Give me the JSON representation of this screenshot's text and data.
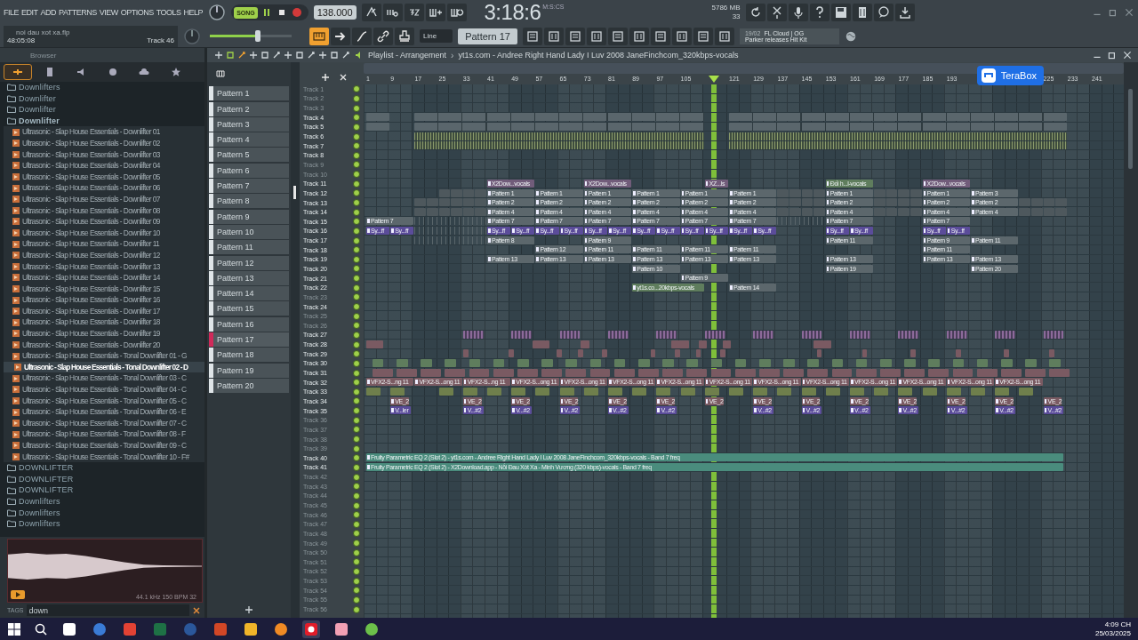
{
  "menu": [
    "FILE",
    "EDIT",
    "ADD",
    "PATTERNS",
    "VIEW",
    "OPTIONS",
    "TOOLS",
    "HELP"
  ],
  "transport": {
    "song_label": "SONG",
    "song_on": true,
    "tempo": "138.000",
    "time": "3:18:6",
    "time_unit": "M:S:CS",
    "memory": "5786 MB",
    "cpu": "33"
  },
  "hint": {
    "file": "noi dau xot xa.flp",
    "position": "48:05:08",
    "track": "Track 46"
  },
  "master": {
    "level": 0.59
  },
  "tool_toggle": {
    "on": true
  },
  "snap": "Line",
  "pattern_selector": "Pattern 17",
  "news": {
    "date": "19/02",
    "title": "FL Cloud | OG",
    "text": "Parker releases Hit Kit"
  },
  "browser": {
    "title": "Browser",
    "tabs": [
      {
        "selected": true
      },
      {
        "selected": false
      },
      {
        "selected": false
      },
      {
        "selected": false
      },
      {
        "selected": false
      },
      {
        "selected": false
      }
    ],
    "tree": [
      {
        "label": "Downlifters",
        "expanded": false
      },
      {
        "label": "Downlifter",
        "expanded": false
      },
      {
        "label": "Downlifter",
        "expanded": false
      },
      {
        "label": "Downlifter",
        "expanded": true,
        "children": [
          {
            "label": "Ultrasonic - Slap House Essentials - Downlifter 01",
            "selected": false
          },
          {
            "label": "Ultrasonic - Slap House Essentials - Downlifter 02",
            "selected": false
          },
          {
            "label": "Ultrasonic - Slap House Essentials - Downlifter 03",
            "selected": false
          },
          {
            "label": "Ultrasonic - Slap House Essentials - Downlifter 04",
            "selected": false
          },
          {
            "label": "Ultrasonic - Slap House Essentials - Downlifter 05",
            "selected": false
          },
          {
            "label": "Ultrasonic - Slap House Essentials - Downlifter 06",
            "selected": false
          },
          {
            "label": "Ultrasonic - Slap House Essentials - Downlifter 07",
            "selected": false
          },
          {
            "label": "Ultrasonic - Slap House Essentials - Downlifter 08",
            "selected": false
          },
          {
            "label": "Ultrasonic - Slap House Essentials - Downlifter 09",
            "selected": false
          },
          {
            "label": "Ultrasonic - Slap House Essentials - Downlifter 10",
            "selected": false
          },
          {
            "label": "Ultrasonic - Slap House Essentials - Downlifter 11",
            "selected": false
          },
          {
            "label": "Ultrasonic - Slap House Essentials - Downlifter 12",
            "selected": false
          },
          {
            "label": "Ultrasonic - Slap House Essentials - Downlifter 13",
            "selected": false
          },
          {
            "label": "Ultrasonic - Slap House Essentials - Downlifter 14",
            "selected": false
          },
          {
            "label": "Ultrasonic - Slap House Essentials - Downlifter 15",
            "selected": false
          },
          {
            "label": "Ultrasonic - Slap House Essentials - Downlifter 16",
            "selected": false
          },
          {
            "label": "Ultrasonic - Slap House Essentials - Downlifter 17",
            "selected": false
          },
          {
            "label": "Ultrasonic - Slap House Essentials - Downlifter 18",
            "selected": false
          },
          {
            "label": "Ultrasonic - Slap House Essentials - Downlifter 19",
            "selected": false
          },
          {
            "label": "Ultrasonic - Slap House Essentials - Downlifter 20",
            "selected": false
          },
          {
            "label": "Ultrasonic - Slap House Essentials - Tonal Downlifter 01 - G",
            "selected": false
          },
          {
            "label": "Ultrasonic - Slap House Essentials - Tonal Downlifter 02 - D",
            "selected": true
          },
          {
            "label": "Ultrasonic - Slap House Essentials - Tonal Downlifter 03 - C",
            "selected": false
          },
          {
            "label": "Ultrasonic - Slap House Essentials - Tonal Downlifter 04 - C",
            "selected": false
          },
          {
            "label": "Ultrasonic - Slap House Essentials - Tonal Downlifter 05 - C",
            "selected": false
          },
          {
            "label": "Ultrasonic - Slap House Essentials - Tonal Downlifter 06 - E",
            "selected": false
          },
          {
            "label": "Ultrasonic - Slap House Essentials - Tonal Downlifter 07 - C",
            "selected": false
          },
          {
            "label": "Ultrasonic - Slap House Essentials - Tonal Downlifter 08 - F",
            "selected": false
          },
          {
            "label": "Ultrasonic - Slap House Essentials - Tonal Downlifter 09 - C",
            "selected": false
          },
          {
            "label": "Ultrasonic - Slap House Essentials - Tonal Downlifter 10 - F#",
            "selected": false
          }
        ]
      },
      {
        "label": "DOWNLIFTER",
        "expanded": false
      },
      {
        "label": "DOWNLIFTER",
        "expanded": false
      },
      {
        "label": "DOWNLIFTER",
        "expanded": false
      },
      {
        "label": "Downlifters",
        "expanded": false
      },
      {
        "label": "Downlifters",
        "expanded": false
      },
      {
        "label": "Downlifters",
        "expanded": false
      }
    ],
    "sample_info": "44.1 kHz 150 BPM 32",
    "tags_label": "TAGS",
    "search": "down"
  },
  "playlist": {
    "title": "Playlist - Arrangement",
    "separator": "›",
    "arrangement": "yt1s.com - Andree Right Hand  Lady I Luv 2008 JaneFinchcom_320kbps-vocals"
  },
  "patterns": [
    {
      "label": "Pattern 1",
      "selected": false
    },
    {
      "label": "Pattern 2",
      "selected": false
    },
    {
      "label": "Pattern 3",
      "selected": false
    },
    {
      "label": "Pattern 4",
      "selected": false
    },
    {
      "label": "Pattern 5",
      "selected": false
    },
    {
      "label": "Pattern 6",
      "selected": false
    },
    {
      "label": "Pattern 7",
      "selected": false
    },
    {
      "label": "Pattern 8",
      "selected": false
    },
    {
      "label": "Pattern 9",
      "selected": false
    },
    {
      "label": "Pattern 10",
      "selected": false
    },
    {
      "label": "Pattern 11",
      "selected": false
    },
    {
      "label": "Pattern 12",
      "selected": false
    },
    {
      "label": "Pattern 13",
      "selected": false
    },
    {
      "label": "Pattern 14",
      "selected": false
    },
    {
      "label": "Pattern 15",
      "selected": false
    },
    {
      "label": "Pattern 16",
      "selected": false
    },
    {
      "label": "Pattern 17",
      "selected": true
    },
    {
      "label": "Pattern 18",
      "selected": false
    },
    {
      "label": "Pattern 19",
      "selected": false
    },
    {
      "label": "Pattern 20",
      "selected": false
    }
  ],
  "ruler": [
    "1",
    "9",
    "17",
    "25",
    "33",
    "41",
    "49",
    "57",
    "65",
    "73",
    "81",
    "89",
    "97",
    "105",
    "121",
    "129",
    "137",
    "145",
    "153",
    "161",
    "169",
    "177",
    "185",
    "193",
    "225",
    "233",
    "241"
  ],
  "playhead": {
    "level": 0.461
  },
  "overlay_badge": "TeraBox",
  "tracks": [
    {
      "name": "Track 1",
      "empty": true
    },
    {
      "name": "Track 2",
      "empty": true
    },
    {
      "name": "Track 3",
      "empty": true
    },
    {
      "name": "Track 4",
      "empty": false
    },
    {
      "name": "Track 5",
      "empty": false
    },
    {
      "name": "Track 6",
      "empty": false
    },
    {
      "name": "Track 7",
      "empty": false
    },
    {
      "name": "Track 8",
      "empty": false
    },
    {
      "name": "Track 9",
      "empty": true
    },
    {
      "name": "Track 10",
      "empty": true
    },
    {
      "name": "Track 11",
      "empty": false,
      "clips": [
        {
          "kind": "audio",
          "label": "X2Dow...vocals"
        },
        {
          "kind": "audio",
          "label": "X2Dow...vocals"
        },
        {
          "kind": "audio",
          "label": "XZ...ls"
        },
        {
          "kind": "sound",
          "label": "Đối h...l-vocals"
        },
        {
          "kind": "audio",
          "label": "X2Dow...vocals"
        }
      ]
    },
    {
      "name": "Track 12",
      "empty": false,
      "clips": [
        {
          "kind": "pattern",
          "label": "Pattern 1"
        },
        {
          "kind": "pattern",
          "label": "Pattern 1"
        },
        {
          "kind": "pattern",
          "label": "Pattern 1"
        },
        {
          "kind": "pattern",
          "label": "Pattern 1"
        },
        {
          "kind": "pattern",
          "label": "Pattern 1"
        },
        {
          "kind": "pattern",
          "label": "Pattern 1"
        },
        {
          "kind": "pattern",
          "label": "Pattern 1"
        },
        {
          "kind": "pattern",
          "label": "Pattern 1"
        },
        {
          "kind": "pattern",
          "label": "Pattern 3"
        }
      ]
    },
    {
      "name": "Track 13",
      "empty": false,
      "clips": [
        {
          "kind": "pattern",
          "label": "Pattern 2"
        },
        {
          "kind": "pattern",
          "label": "Pattern 2"
        },
        {
          "kind": "pattern",
          "label": "Pattern 2"
        },
        {
          "kind": "pattern",
          "label": "Pattern 2"
        },
        {
          "kind": "pattern",
          "label": "Pattern 2"
        },
        {
          "kind": "pattern",
          "label": "Pattern 2"
        },
        {
          "kind": "pattern",
          "label": "Pattern 2"
        },
        {
          "kind": "pattern",
          "label": "Pattern 2"
        },
        {
          "kind": "pattern",
          "label": "Pattern 2"
        }
      ]
    },
    {
      "name": "Track 14",
      "empty": false,
      "clips": [
        {
          "kind": "pattern",
          "label": "Pattern 4"
        },
        {
          "kind": "pattern",
          "label": "Pattern 4"
        },
        {
          "kind": "pattern",
          "label": "Pattern 4"
        },
        {
          "kind": "pattern",
          "label": "Pattern 4"
        },
        {
          "kind": "pattern",
          "label": "Pattern 4"
        },
        {
          "kind": "pattern",
          "label": "Pattern 4"
        },
        {
          "kind": "pattern",
          "label": "Pattern 4"
        },
        {
          "kind": "pattern",
          "label": "Pattern 4"
        },
        {
          "kind": "pattern",
          "label": "Pattern 4"
        }
      ]
    },
    {
      "name": "Track 15",
      "empty": false,
      "clips": [
        {
          "kind": "pattern",
          "label": "Pattern 7"
        },
        {
          "kind": "pattern",
          "label": "Pattern 7"
        },
        {
          "kind": "pattern",
          "label": "Pattern 7"
        },
        {
          "kind": "pattern",
          "label": "Pattern 7"
        },
        {
          "kind": "pattern",
          "label": "Pattern 7"
        },
        {
          "kind": "pattern",
          "label": "Pattern 7"
        },
        {
          "kind": "pattern",
          "label": "Pattern 7"
        },
        {
          "kind": "pattern",
          "label": "Pattern 7"
        },
        {
          "kind": "pattern",
          "label": "Pattern 7"
        }
      ]
    },
    {
      "name": "Track 16",
      "empty": false,
      "clips": [
        {
          "kind": "automation",
          "label": "Sy...ff"
        },
        {
          "kind": "automation",
          "label": "Sy...ff"
        },
        {
          "kind": "automation",
          "label": "Sy...ff"
        },
        {
          "kind": "automation",
          "label": "Sy...ff"
        },
        {
          "kind": "automation",
          "label": "Sy...ff"
        },
        {
          "kind": "automation",
          "label": "Sy...ff"
        },
        {
          "kind": "automation",
          "label": "Sy...ff"
        },
        {
          "kind": "automation",
          "label": "Sy...ff"
        },
        {
          "kind": "automation",
          "label": "Sy...ff"
        },
        {
          "kind": "automation",
          "label": "Sy...ff"
        },
        {
          "kind": "automation",
          "label": "Sy...ff"
        },
        {
          "kind": "automation",
          "label": "Sy...ff"
        },
        {
          "kind": "automation",
          "label": "Sy...ff"
        },
        {
          "kind": "automation",
          "label": "Sy...ff"
        },
        {
          "kind": "automation",
          "label": "Sy...ff"
        },
        {
          "kind": "automation",
          "label": "Sy...ff"
        },
        {
          "kind": "automation",
          "label": "Sy...ff"
        },
        {
          "kind": "automation",
          "label": "Sy...ff"
        }
      ]
    },
    {
      "name": "Track 17",
      "empty": false,
      "clips": [
        {
          "kind": "pattern",
          "label": "Pattern 8"
        },
        {
          "kind": "pattern",
          "label": "Pattern 9"
        },
        {
          "kind": "pattern",
          "label": "Pattern 11"
        },
        {
          "kind": "pattern",
          "label": "Pattern 9"
        },
        {
          "kind": "pattern",
          "label": "Pattern 11"
        }
      ]
    },
    {
      "name": "Track 18",
      "empty": false,
      "clips": [
        {
          "kind": "pattern",
          "label": "Pattern 12"
        },
        {
          "kind": "pattern",
          "label": "Pattern 11"
        },
        {
          "kind": "pattern",
          "label": "Pattern 11"
        },
        {
          "kind": "pattern",
          "label": "Pattern 11"
        },
        {
          "kind": "pattern",
          "label": "Pattern 11"
        },
        {
          "kind": "pattern",
          "label": "Pattern 11"
        }
      ]
    },
    {
      "name": "Track 19",
      "empty": false,
      "clips": [
        {
          "kind": "pattern",
          "label": "Pattern 13"
        },
        {
          "kind": "pattern",
          "label": "Pattern 13"
        },
        {
          "kind": "pattern",
          "label": "Pattern 13"
        },
        {
          "kind": "pattern",
          "label": "Pattern 13"
        },
        {
          "kind": "pattern",
          "label": "Pattern 13"
        },
        {
          "kind": "pattern",
          "label": "Pattern 13"
        },
        {
          "kind": "pattern",
          "label": "Pattern 13"
        },
        {
          "kind": "pattern",
          "label": "Pattern 13"
        },
        {
          "kind": "pattern",
          "label": "Pattern 13"
        }
      ]
    },
    {
      "name": "Track 20",
      "empty": false,
      "clips": [
        {
          "kind": "pattern",
          "label": "Pattern 10"
        },
        {
          "kind": "pattern",
          "label": "Pattern 19"
        },
        {
          "kind": "pattern",
          "label": "Pattern 20"
        }
      ]
    },
    {
      "name": "Track 21",
      "empty": false,
      "clips": [
        {
          "kind": "pattern",
          "label": "Pattern 9"
        }
      ]
    },
    {
      "name": "Track 22",
      "empty": false,
      "clips": [
        {
          "kind": "sound",
          "label": "yt1s.co...20kbps-vocals"
        },
        {
          "kind": "pattern",
          "label": "Pattern 14"
        }
      ]
    },
    {
      "name": "Track 23",
      "empty": true
    },
    {
      "name": "Track 24",
      "empty": false
    },
    {
      "name": "Track 25",
      "empty": true
    },
    {
      "name": "Track 26",
      "empty": true
    },
    {
      "name": "Track 27",
      "empty": false
    },
    {
      "name": "Track 28",
      "empty": false
    },
    {
      "name": "Track 29",
      "empty": false
    },
    {
      "name": "Track 30",
      "empty": false
    },
    {
      "name": "Track 31",
      "empty": false
    },
    {
      "name": "Track 32",
      "empty": false,
      "clips": [
        {
          "kind": "fx",
          "label": "VFX2-S...ng 11"
        },
        {
          "kind": "fx",
          "label": "VFX2-S...ong 11"
        },
        {
          "kind": "fx",
          "label": "VFX2-S...ng 11"
        },
        {
          "kind": "fx",
          "label": "VFX2-S...ong 11"
        },
        {
          "kind": "fx",
          "label": "VFX2-S...ong 11"
        },
        {
          "kind": "fx",
          "label": "VFX2-S...ong 11"
        },
        {
          "kind": "fx",
          "label": "VFX2-S...ong 11"
        },
        {
          "kind": "fx",
          "label": "VFX2-S...ong 11"
        },
        {
          "kind": "fx",
          "label": "VFX2-S...ong 11"
        },
        {
          "kind": "fx",
          "label": "VFX2-S...ong 11"
        },
        {
          "kind": "fx",
          "label": "VFX2-S...ong 11"
        },
        {
          "kind": "fx",
          "label": "VFX2-S...ong 11"
        },
        {
          "kind": "fx",
          "label": "VFX2-S...ong 11"
        },
        {
          "kind": "fx",
          "label": "VFX2-S...ong 11"
        }
      ]
    },
    {
      "name": "Track 33",
      "empty": false
    },
    {
      "name": "Track 34",
      "empty": false,
      "clips": [
        {
          "kind": "fx",
          "label": "VE_2"
        },
        {
          "kind": "fx",
          "label": "VE_2"
        },
        {
          "kind": "fx",
          "label": "VE_2"
        },
        {
          "kind": "fx",
          "label": "VE_2"
        },
        {
          "kind": "fx",
          "label": "VE_2"
        },
        {
          "kind": "fx",
          "label": "VE_2"
        },
        {
          "kind": "fx",
          "label": "VE_2"
        },
        {
          "kind": "fx",
          "label": "VE_2"
        },
        {
          "kind": "fx",
          "label": "VE_2"
        },
        {
          "kind": "fx",
          "label": "VE_2"
        },
        {
          "kind": "fx",
          "label": "VE_2"
        },
        {
          "kind": "fx",
          "label": "VE_2"
        },
        {
          "kind": "fx",
          "label": "VE_2"
        },
        {
          "kind": "fx",
          "label": "VE_2"
        }
      ]
    },
    {
      "name": "Track 35",
      "empty": false,
      "clips": [
        {
          "kind": "automation",
          "label": "V...ler"
        },
        {
          "kind": "automation",
          "label": "V...#2"
        },
        {
          "kind": "automation",
          "label": "V...#2"
        },
        {
          "kind": "automation",
          "label": "V...#2"
        },
        {
          "kind": "automation",
          "label": "V...#2"
        },
        {
          "kind": "automation",
          "label": "V...#2"
        },
        {
          "kind": "automation",
          "label": "V...#2"
        },
        {
          "kind": "automation",
          "label": "V...#2"
        },
        {
          "kind": "automation",
          "label": "V...#2"
        },
        {
          "kind": "automation",
          "label": "V...#2"
        },
        {
          "kind": "automation",
          "label": "V...#2"
        },
        {
          "kind": "automation",
          "label": "V...#2"
        },
        {
          "kind": "automation",
          "label": "V...#2"
        }
      ]
    },
    {
      "name": "Track 36",
      "empty": true
    },
    {
      "name": "Track 37",
      "empty": true
    },
    {
      "name": "Track 38",
      "empty": true
    },
    {
      "name": "Track 39",
      "empty": true
    },
    {
      "name": "Track 40",
      "empty": false,
      "clips": [
        {
          "kind": "eq",
          "label": "Fruity Parametric EQ 2 (Slot 2) - yt1s.com - Andree Right Hand  Lady I Luv 2008 JaneFinchcom_320kbps-vocals - Band 7 freq"
        }
      ]
    },
    {
      "name": "Track 41",
      "empty": false,
      "clips": [
        {
          "kind": "eq",
          "label": "Fruity Parametric EQ 2 (Slot 2) - X2Download.app - Nỗi Đau Xót Xa - Minh Vương (320 kbps)-vocals - Band 7 freq"
        }
      ]
    },
    {
      "name": "Track 42",
      "empty": true
    },
    {
      "name": "Track 43",
      "empty": true
    },
    {
      "name": "Track 44",
      "empty": true
    },
    {
      "name": "Track 45",
      "empty": true
    },
    {
      "name": "Track 46",
      "empty": true
    },
    {
      "name": "Track 47",
      "empty": true
    },
    {
      "name": "Track 48",
      "empty": true
    },
    {
      "name": "Track 49",
      "empty": true
    },
    {
      "name": "Track 50",
      "empty": true
    },
    {
      "name": "Track 51",
      "empty": true
    },
    {
      "name": "Track 52",
      "empty": true
    },
    {
      "name": "Track 53",
      "empty": true
    },
    {
      "name": "Track 54",
      "empty": true
    },
    {
      "name": "Track 55",
      "empty": true
    },
    {
      "name": "Track 56",
      "empty": true
    }
  ],
  "taskbar": {
    "apps": [
      {
        "selected": false
      },
      {
        "selected": false
      },
      {
        "selected": false
      },
      {
        "selected": false
      },
      {
        "selected": false
      },
      {
        "selected": false
      },
      {
        "selected": false
      },
      {
        "selected": false
      },
      {
        "selected": false
      },
      {
        "selected": false
      },
      {
        "selected": true
      },
      {
        "selected": false
      },
      {
        "selected": false
      }
    ],
    "time": "4:09 CH",
    "date": "25/03/2025"
  }
}
